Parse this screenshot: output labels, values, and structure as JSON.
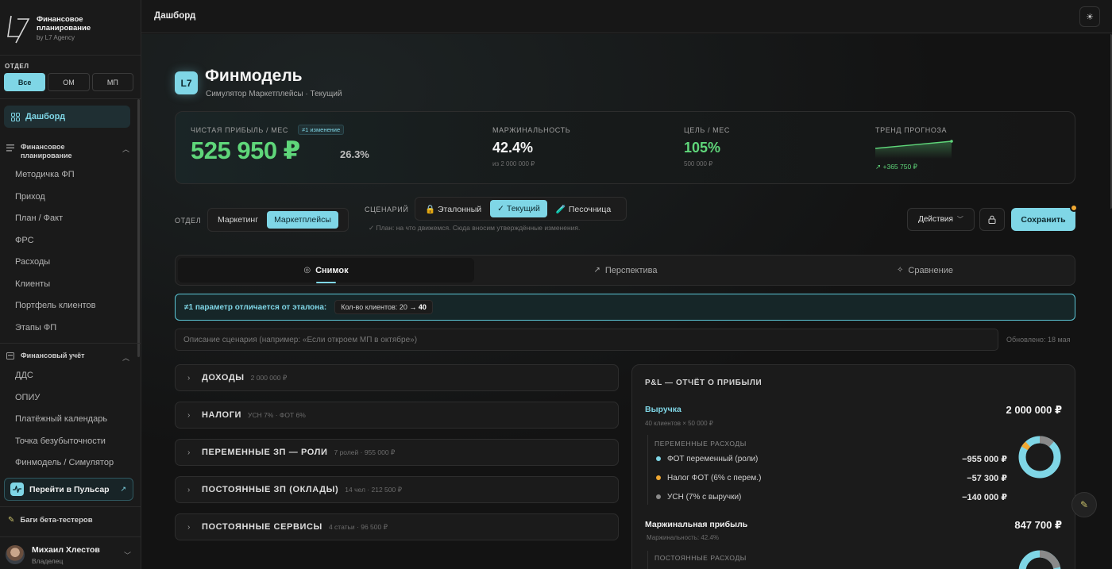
{
  "brand": {
    "title": "Финансовое планирование",
    "subtitle": "by L7 Agency"
  },
  "sidebar": {
    "department_label": "ОТДЕЛ",
    "departments": [
      {
        "label": "Все",
        "active": true
      },
      {
        "label": "ОМ",
        "active": false
      },
      {
        "label": "МП",
        "active": false
      }
    ],
    "dashboard_label": "Дашборд",
    "group_fp": {
      "title": "Финансовое планирование",
      "items": [
        "Методичка ФП",
        "Приход",
        "План / Факт",
        "ФРС",
        "Расходы",
        "Клиенты",
        "Портфель клиентов",
        "Этапы ФП"
      ]
    },
    "group_fu": {
      "title": "Финансовый учёт",
      "items": [
        "ДДС",
        "ОПИУ",
        "Платёжный календарь",
        "Точка безубыточности",
        "Финмодель / Симулятор"
      ]
    },
    "pulsar_label": "Перейти в Пульсар",
    "bugs_label": "Баги бета-тестеров",
    "user": {
      "name": "Михаил Хлестов",
      "role": "Владелец"
    }
  },
  "topbar": {
    "title": "Дашборд"
  },
  "header": {
    "logo": "L7",
    "title": "Финмодель",
    "subtitle": "Симулятор Маркетплейсы · Текущий"
  },
  "kpi": {
    "profit": {
      "label": "ЧИСТАЯ ПРИБЫЛЬ / МЕС",
      "badge": "≠1 изменение",
      "value": "525 950 ₽",
      "percent": "26.3%"
    },
    "margin": {
      "label": "МАРЖИНАЛЬНОСТЬ",
      "value": "42.4%",
      "sub": "из 2 000 000 ₽"
    },
    "goal": {
      "label": "ЦЕЛЬ / МЕС",
      "value": "105%",
      "sub": "500 000 ₽"
    },
    "trend": {
      "label": "ТРЕНД ПРОГНОЗА",
      "value": "+365 750 ₽"
    }
  },
  "controls": {
    "dept_label": "ОТДЕЛ",
    "dept_options": [
      {
        "label": "Маркетинг",
        "active": false
      },
      {
        "label": "Маркетплейсы",
        "active": true
      }
    ],
    "scenario_label": "СЦЕНАРИЙ",
    "scenario_options": [
      {
        "label": "🔒 Эталонный",
        "active": false
      },
      {
        "label": "✓ Текущий",
        "active": true
      },
      {
        "label": "🧪 Песочница",
        "active": false
      }
    ],
    "scenario_note": "✓ План: на что движемся. Сюда вносим утверждённые изменения.",
    "actions_label": "Действия",
    "save_label": "Сохранить"
  },
  "tabs": [
    {
      "label": "Снимок",
      "icon": "target-icon",
      "active": true
    },
    {
      "label": "Перспектива",
      "icon": "trend-icon",
      "active": false
    },
    {
      "label": "Сравнение",
      "icon": "sparkle-icon",
      "active": false
    }
  ],
  "diff_banner": {
    "text": "≠1 параметр отличается от эталона:",
    "chip_label": "Кол-во клиентов:",
    "chip_from": "20",
    "chip_to": "40"
  },
  "description": {
    "placeholder": "Описание сценария (например: «Если откроем МП в октябре»)",
    "updated": "Обновлено: 18 мая"
  },
  "sections": [
    {
      "title": "ДОХОДЫ",
      "meta": "2 000 000 ₽"
    },
    {
      "title": "НАЛОГИ",
      "meta": "УСН 7% · ФОТ 6%"
    },
    {
      "title": "ПЕРЕМЕННЫЕ ЗП — РОЛИ",
      "meta": "7 ролей · 955 000 ₽"
    },
    {
      "title": "ПОСТОЯННЫЕ ЗП (ОКЛАДЫ)",
      "meta": "14 чел · 212 500 ₽"
    },
    {
      "title": "ПОСТОЯННЫЕ СЕРВИСЫ",
      "meta": "4 статьи · 96 500 ₽"
    }
  ],
  "pl": {
    "title": "P&L — ОТЧЁТ О ПРИБЫЛИ",
    "revenue": {
      "label": "Выручка",
      "sub": "40 клиентов × 50 000 ₽",
      "value": "2 000 000 ₽"
    },
    "variable_title": "ПЕРЕМЕННЫЕ РАСХОДЫ",
    "variable": [
      {
        "label": "ФОТ переменный (роли)",
        "value": "−955 000 ₽",
        "color": "#7fd6e6"
      },
      {
        "label": "Налог ФОТ (6% с перем.)",
        "value": "−57 300 ₽",
        "color": "#f0a832"
      },
      {
        "label": "УСН (7% с выручки)",
        "value": "−140 000 ₽",
        "color": "#8a8a8a"
      }
    ],
    "margin": {
      "label": "Маржинальная прибыль",
      "sub": "Маржинальность: 42.4%",
      "value": "847 700 ₽"
    },
    "fixed_title": "ПОСТОЯННЫЕ РАСХОДЫ"
  }
}
